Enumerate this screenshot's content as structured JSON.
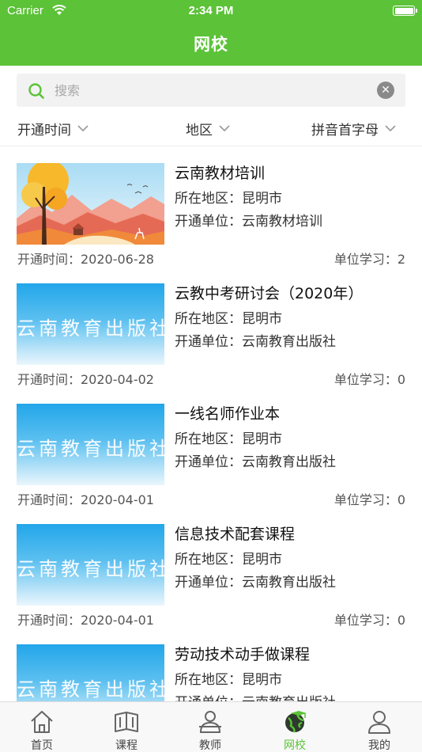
{
  "status_bar": {
    "carrier": "Carrier",
    "time": "2:34 PM"
  },
  "nav": {
    "title": "网校"
  },
  "search": {
    "placeholder": "搜索",
    "clear_symbol": "✕"
  },
  "filters": [
    {
      "label": "开通时间"
    },
    {
      "label": "地区"
    },
    {
      "label": "拼音首字母"
    }
  ],
  "schools": [
    {
      "title": "云南教材培训",
      "region": "所在地区：昆明市",
      "unit": "开通单位：云南教材培训",
      "opened": "开通时间：2020-06-28",
      "study": "单位学习：2",
      "thumb": "landscape"
    },
    {
      "title": "云教中考研讨会（2020年）",
      "region": "所在地区：昆明市",
      "unit": "开通单位：云南教育出版社",
      "opened": "开通时间：2020-04-02",
      "study": "单位学习：0",
      "thumb": "publisher",
      "thumb_text": "云南教育出版社"
    },
    {
      "title": "一线名师作业本",
      "region": "所在地区：昆明市",
      "unit": "开通单位：云南教育出版社",
      "opened": "开通时间：2020-04-01",
      "study": "单位学习：0",
      "thumb": "publisher",
      "thumb_text": "云南教育出版社"
    },
    {
      "title": "信息技术配套课程",
      "region": "所在地区：昆明市",
      "unit": "开通单位：云南教育出版社",
      "opened": "开通时间：2020-04-01",
      "study": "单位学习：0",
      "thumb": "publisher",
      "thumb_text": "云南教育出版社"
    },
    {
      "title": "劳动技术动手做课程",
      "region": "所在地区：昆明市",
      "unit": "开通单位：云南教育出版社",
      "opened": "",
      "study": "",
      "thumb": "publisher",
      "thumb_text": "云南教育出版社"
    }
  ],
  "tabbar": [
    {
      "label": "首页",
      "icon": "home-icon"
    },
    {
      "label": "课程",
      "icon": "book-icon"
    },
    {
      "label": "教师",
      "icon": "teacher-icon"
    },
    {
      "label": "网校",
      "icon": "globe-school-icon",
      "active": true
    },
    {
      "label": "我的",
      "icon": "profile-icon"
    }
  ],
  "colors": {
    "brand_green": "#5cc238",
    "tab_inactive": "#444444"
  }
}
